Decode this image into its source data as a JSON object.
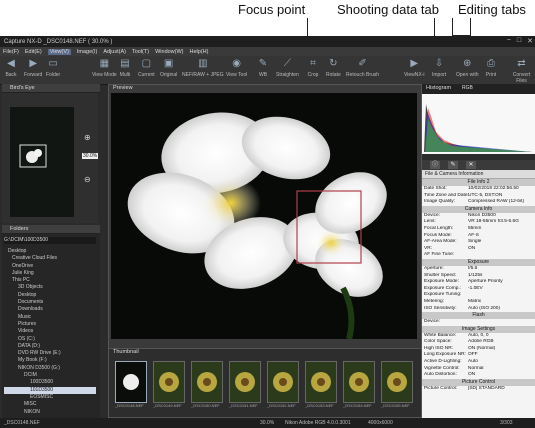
{
  "annotations": {
    "focus_point": "Focus point",
    "shooting_data_tab": "Shooting data tab",
    "editing_tabs": "Editing tabs"
  },
  "window": {
    "title": "Capture NX-D   _DSC0148.NEF ( 30.0% )",
    "controls": [
      "−",
      "□",
      "✕"
    ]
  },
  "menu": [
    "File(F)",
    "Edit(E)",
    "View(V)",
    "Image(I)",
    "Adjust(A)",
    "Tool(T)",
    "Window(W)",
    "Help(H)"
  ],
  "toolbar": {
    "items": [
      {
        "label": "Back",
        "icon": "back-arrow-icon",
        "glyph": "◀"
      },
      {
        "label": "Forward",
        "icon": "forward-arrow-icon",
        "glyph": "▶"
      },
      {
        "label": "Folder",
        "icon": "folder-icon",
        "glyph": "▭"
      },
      {
        "label": "View Mode",
        "icon": "view-mode-icon",
        "glyph": "▦"
      },
      {
        "label": "Multi",
        "icon": "multi-icon",
        "glyph": "▤"
      },
      {
        "label": "Current",
        "icon": "current-icon",
        "glyph": "▢"
      },
      {
        "label": "Original",
        "icon": "original-icon",
        "glyph": "▣"
      },
      {
        "label": "NEF/RAW + JPEG",
        "icon": "nef-raw-icon",
        "glyph": "▥"
      },
      {
        "label": "View Tool",
        "icon": "view-tool-icon",
        "glyph": "◉"
      },
      {
        "label": "WB",
        "icon": "white-balance-icon",
        "glyph": "✎"
      },
      {
        "label": "Straighten",
        "icon": "straighten-icon",
        "glyph": "⟋"
      },
      {
        "label": "Crop",
        "icon": "crop-icon",
        "glyph": "⌗"
      },
      {
        "label": "Rotate",
        "icon": "rotate-icon",
        "glyph": "↻"
      },
      {
        "label": "Retouch Brush",
        "icon": "retouch-brush-icon",
        "glyph": "✐"
      },
      {
        "label": "ViewNX-i",
        "icon": "viewnx-icon",
        "glyph": "▶"
      },
      {
        "label": "Import",
        "icon": "import-icon",
        "glyph": "⇩"
      },
      {
        "label": "Open with",
        "icon": "open-with-icon",
        "glyph": "⊕"
      },
      {
        "label": "Print",
        "icon": "print-icon",
        "glyph": "⎙"
      },
      {
        "label": "Convert Files",
        "icon": "convert-files-icon",
        "glyph": "⇄"
      }
    ]
  },
  "birds_eye": {
    "title": "Bird's Eye",
    "zoom": "30.0%"
  },
  "folders": {
    "title": "Folders",
    "path": "G:\\DCIM\\100D3500",
    "tree": [
      "Desktop",
      "Creative Cloud Files",
      "OneDrive",
      "Julie King",
      "This PC",
      "3D Objects",
      "Desktop",
      "Documents",
      "Downloads",
      "Music",
      "Pictures",
      "Videos",
      "OS (C:)",
      "DATA (D:)",
      "DVD RW Drive (E:)",
      "My Book (F:)",
      "NIKON D3500 (G:)",
      "DCIM",
      "100D3500",
      "101D3500",
      "EOSMISC",
      "MISC",
      "NIKON"
    ]
  },
  "preview": {
    "title": "Preview"
  },
  "thumbnail": {
    "title": "Thumbnail",
    "items": [
      "_DSC0148.NEF",
      "_DSC0149.NEF",
      "_DSC0150.NEF",
      "_DSC0151.NEF",
      "_DSC0152.NEF",
      "_DSC0153.NEF",
      "_DSC0154.NEF",
      "_DSC0155.NEF"
    ]
  },
  "histogram": {
    "title": "Histogram",
    "channel": "RGB"
  },
  "info_panel": {
    "title": "File & Camera Information",
    "sections": [
      {
        "name": "File Info 2",
        "rows": [
          [
            "Date Shot:",
            "10/02/2018 22:02:56.50"
          ],
          [
            "Time Zone and Date:",
            "UTC-5, DST:ON"
          ],
          [
            "Image Quality:",
            "Compressed RAW (12-bit)"
          ]
        ]
      },
      {
        "name": "Camera Info",
        "rows": [
          [
            "Device:",
            "Nikon D3500"
          ],
          [
            "Lens:",
            "VR 18-55mm f/3.5-5.6G"
          ],
          [
            "Focal Length:",
            "55mm"
          ],
          [
            "Focus Mode:",
            "AF-S"
          ],
          [
            "AF-Area Mode:",
            "Single"
          ],
          [
            "VR:",
            "ON"
          ],
          [
            "AF Fine Tune:",
            ""
          ]
        ]
      },
      {
        "name": "Exposure",
        "rows": [
          [
            "Aperture:",
            "f/5.6"
          ],
          [
            "Shutter Speed:",
            "1/125s"
          ],
          [
            "Exposure Mode:",
            "Aperture Priority"
          ],
          [
            "Exposure Comp.:",
            "-1.0EV"
          ],
          [
            "Exposure Tuning:",
            ""
          ],
          [
            "Metering:",
            "Matrix"
          ],
          [
            "ISO Sensitivity:",
            "Auto (ISO 200)"
          ]
        ]
      },
      {
        "name": "Flash",
        "rows": [
          [
            "Device:",
            ""
          ]
        ]
      },
      {
        "name": "Image Settings",
        "rows": [
          [
            "White Balance:",
            "Auto, 0, 0"
          ],
          [
            "Color Space:",
            "Adobe RGB"
          ],
          [
            "High ISO NR:",
            "ON (Normal)"
          ],
          [
            "Long Exposure NR:",
            "OFF"
          ],
          [
            "Active D-Lighting:",
            "Auto"
          ],
          [
            "Vignette Control:",
            "Normal"
          ],
          [
            "Auto Distortion:",
            "ON"
          ]
        ]
      },
      {
        "name": "Picture Control",
        "rows": [
          [
            "Picture Control:",
            "[SD] STANDARD"
          ]
        ]
      }
    ]
  },
  "status": {
    "file": "_DSC0148.NEF",
    "zoom": "30.0%",
    "camera": "Nikon Adobe RGB 4.0.0.3001",
    "size": "4000x6000",
    "page": "3/303"
  }
}
